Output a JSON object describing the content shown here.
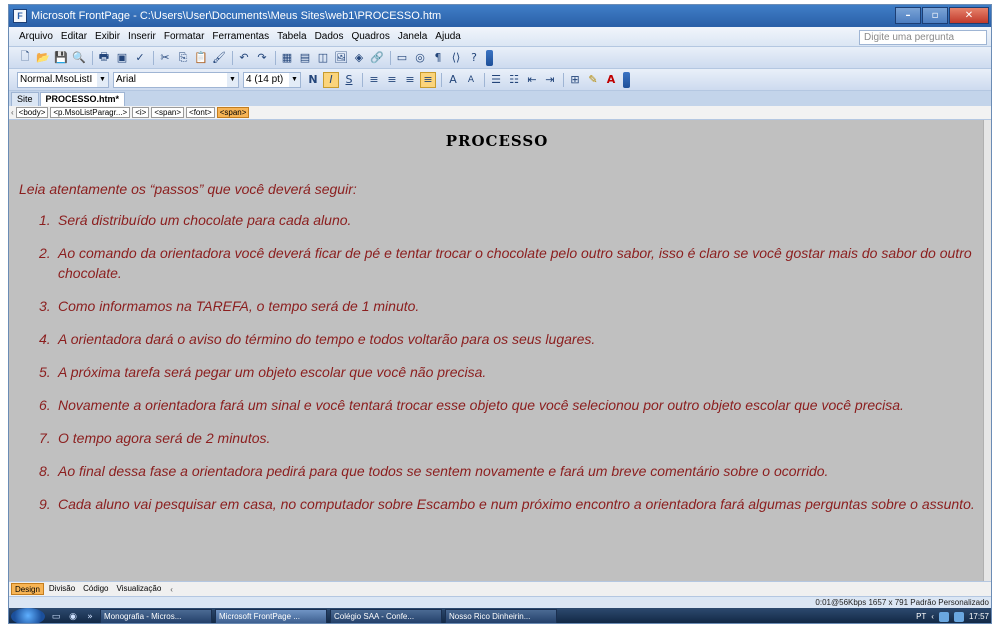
{
  "window": {
    "title": "Microsoft FrontPage - C:\\Users\\User\\Documents\\Meus Sites\\web1\\PROCESSO.htm",
    "app_icon": "frontpage-icon",
    "controls": {
      "minimize": "–",
      "maximize": "▫",
      "close": "✕"
    }
  },
  "menubar": {
    "items": [
      "Arquivo",
      "Editar",
      "Exibir",
      "Inserir",
      "Formatar",
      "Ferramentas",
      "Tabela",
      "Dados",
      "Quadros",
      "Janela",
      "Ajuda"
    ],
    "ask_placeholder": "Digite uma pergunta"
  },
  "toolbar_standard": {
    "icons": [
      "new-page-icon",
      "open-icon",
      "save-icon",
      "search-icon",
      "print-icon",
      "preview-icon",
      "spelling-icon",
      "cut-icon",
      "copy-icon",
      "paste-icon",
      "format-painter-icon",
      "undo-icon",
      "redo-icon",
      "web-component-icon",
      "insert-table-icon",
      "layer-icon",
      "insert-picture-icon",
      "drawing-icon",
      "hyperlink-icon",
      "folder-list-icon",
      "navigation-icon",
      "show-all-icon",
      "code-icon",
      "help-icon"
    ]
  },
  "toolbar_formatting": {
    "style": "Normal.MsoListI",
    "font": "Arial",
    "size": "4  (14 pt)",
    "bold": "N",
    "italic": "I",
    "underline": "S",
    "font_color": "#c00000",
    "highlight_color": "#ffff00"
  },
  "tabs": {
    "site": "Site",
    "document": "PROCESSO.htm*"
  },
  "tagbar": {
    "tags": [
      "<body>",
      "<p.MsoListParagr...>",
      "<i>",
      "<span>",
      "<font>",
      "<span>"
    ],
    "active_index": 5
  },
  "document": {
    "title": "PROCESSO",
    "intro": "Leia atentamente os “passos” que você deverá seguir:",
    "text_color": "#8b1e1e",
    "background": "#c0c0c0",
    "steps": [
      {
        "num": "1.",
        "text": "Será distribuído um chocolate para cada aluno."
      },
      {
        "num": "2.",
        "text": "Ao comando da orientadora você deverá ficar de pé e tentar trocar o chocolate pelo outro sabor, isso é claro se você gostar mais do sabor do outro chocolate."
      },
      {
        "num": "3.",
        "text": "Como informamos na TAREFA, o tempo será de 1 minuto."
      },
      {
        "num": "4.",
        "text": "A orientadora dará o aviso do término do tempo e todos voltarão para os seus lugares."
      },
      {
        "num": "5.",
        "text": "A próxima tarefa será pegar um objeto escolar que você não precisa."
      },
      {
        "num": "6.",
        "text": "Novamente a orientadora fará um sinal e você tentará trocar esse objeto que você selecionou por outro objeto escolar que você precisa."
      },
      {
        "num": "7.",
        "text": "O tempo agora será de 2 minutos."
      },
      {
        "num": "8.",
        "text": "Ao final dessa fase a orientadora pedirá para que todos se sentem novamente e fará um breve comentário sobre o ocorrido."
      },
      {
        "num": "9.",
        "text": "Cada aluno vai pesquisar em casa, no computador sobre Escambo e num próximo encontro a orientadora fará algumas perguntas sobre o assunto."
      }
    ]
  },
  "viewtabs": {
    "design": "Design",
    "split": "Divisão",
    "code": "Código",
    "preview": "Visualização"
  },
  "statusbar": {
    "text": "0:01@56Kbps  1657 x 791  Padrão  Personalizado"
  },
  "taskbar": {
    "tasks": [
      "Monografia - Micros...",
      "Microsoft FrontPage ...",
      "Colégio SAA - Confe...",
      "Nosso Rico Dinheirin..."
    ],
    "active_index": 1,
    "language": "PT",
    "clock": "17:57"
  }
}
